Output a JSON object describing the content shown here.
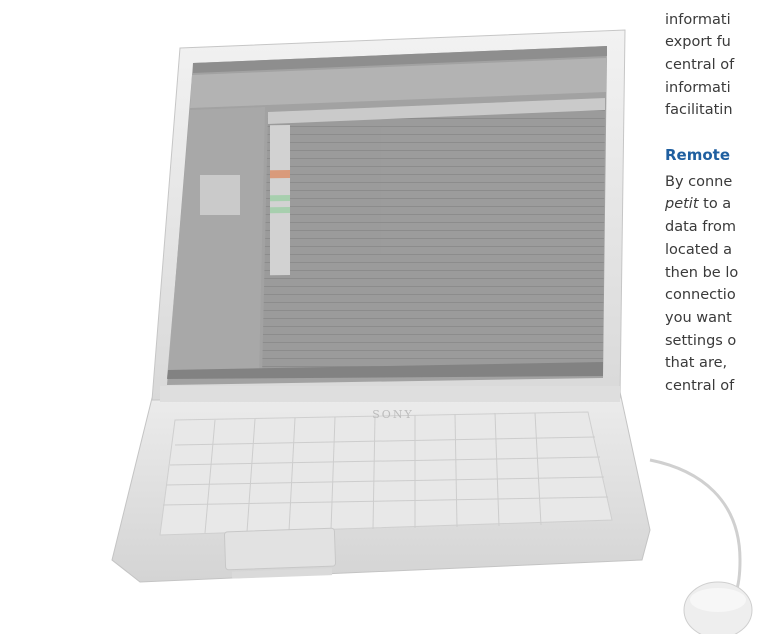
{
  "laptop": {
    "brand": "SONY"
  },
  "article": {
    "para1": [
      "informati",
      "export fu",
      "central of",
      "informati",
      "facilitatin"
    ],
    "heading": "Remote",
    "para2": {
      "line1": "By conne",
      "line2_italic": "petit",
      "line2_rest": " to a",
      "lines": [
        "data from",
        "located a",
        "then be lo",
        "connectio",
        "you want",
        "settings o",
        "that are,",
        "central of"
      ]
    }
  }
}
